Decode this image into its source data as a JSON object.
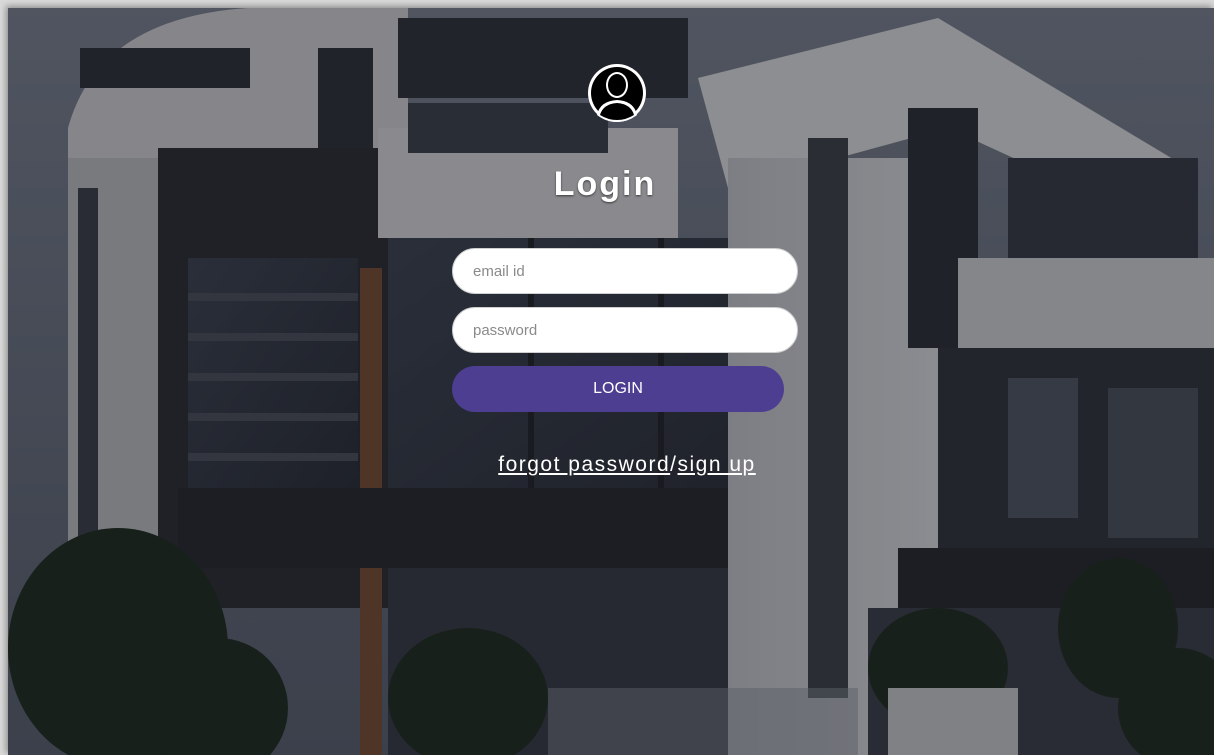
{
  "login": {
    "title": "Login",
    "email_placeholder": "email id",
    "password_placeholder": "password",
    "submit_label": "LOGIN",
    "forgot_password_label": "forgot password",
    "separator": "/",
    "sign_up_label": "sign up"
  },
  "colors": {
    "button_bg": "#4d3e91",
    "text": "#ffffff",
    "field_bg": "#ffffff"
  },
  "icons": {
    "avatar": "user-avatar-icon"
  }
}
